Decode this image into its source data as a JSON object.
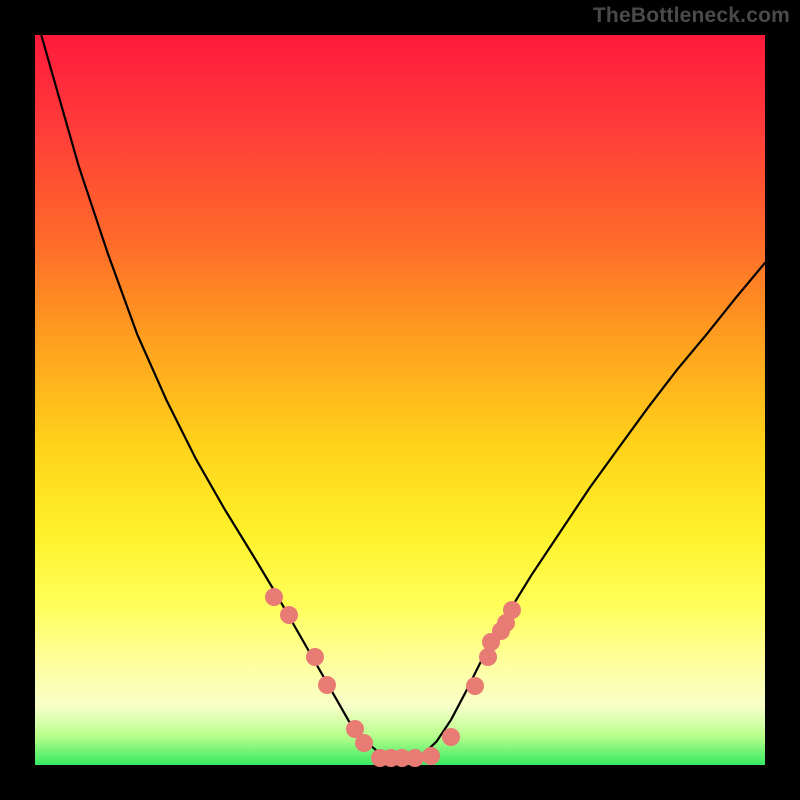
{
  "watermark": "TheBottleneck.com",
  "chart_data": {
    "type": "line",
    "title": "",
    "xlabel": "",
    "ylabel": "",
    "xlim": [
      0,
      1
    ],
    "ylim": [
      0,
      1
    ],
    "x": [
      0.0,
      0.02,
      0.04,
      0.06,
      0.08,
      0.1,
      0.14,
      0.18,
      0.22,
      0.26,
      0.3,
      0.33,
      0.35,
      0.37,
      0.39,
      0.41,
      0.43,
      0.45,
      0.47,
      0.49,
      0.51,
      0.53,
      0.55,
      0.57,
      0.59,
      0.61,
      0.64,
      0.68,
      0.72,
      0.76,
      0.8,
      0.84,
      0.88,
      0.92,
      0.96,
      1.0
    ],
    "y": [
      1.03,
      0.96,
      0.89,
      0.82,
      0.76,
      0.7,
      0.59,
      0.5,
      0.42,
      0.35,
      0.285,
      0.235,
      0.2,
      0.165,
      0.13,
      0.095,
      0.06,
      0.035,
      0.018,
      0.008,
      0.006,
      0.013,
      0.032,
      0.062,
      0.1,
      0.14,
      0.195,
      0.26,
      0.32,
      0.38,
      0.435,
      0.49,
      0.542,
      0.59,
      0.64,
      0.688
    ],
    "series": [
      {
        "name": "datapoints",
        "points": [
          {
            "x": 0.328,
            "y": 0.23
          },
          {
            "x": 0.348,
            "y": 0.205
          },
          {
            "x": 0.383,
            "y": 0.148
          },
          {
            "x": 0.4,
            "y": 0.11
          },
          {
            "x": 0.438,
            "y": 0.05
          },
          {
            "x": 0.45,
            "y": 0.03
          },
          {
            "x": 0.473,
            "y": 0.01
          },
          {
            "x": 0.488,
            "y": 0.01
          },
          {
            "x": 0.503,
            "y": 0.01
          },
          {
            "x": 0.52,
            "y": 0.01
          },
          {
            "x": 0.543,
            "y": 0.013
          },
          {
            "x": 0.57,
            "y": 0.038
          },
          {
            "x": 0.603,
            "y": 0.108
          },
          {
            "x": 0.62,
            "y": 0.148
          },
          {
            "x": 0.625,
            "y": 0.168
          },
          {
            "x": 0.638,
            "y": 0.183
          },
          {
            "x": 0.645,
            "y": 0.195
          },
          {
            "x": 0.653,
            "y": 0.213
          }
        ]
      }
    ],
    "gradient_colors": {
      "top": "#ff1a3c",
      "mid_upper": "#ffa01f",
      "mid": "#ffd21a",
      "mid_lower": "#ffff5a",
      "bottom": "#36e962"
    },
    "point_color": "#e87c74",
    "curve_color": "#000000",
    "background": "#000000"
  }
}
